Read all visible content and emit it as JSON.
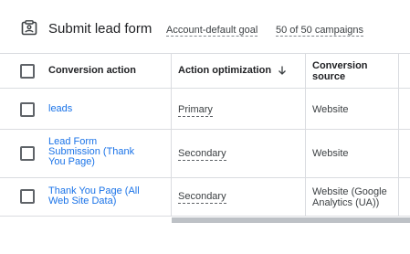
{
  "header": {
    "title": "Submit lead form",
    "goal_label": "Account-default goal",
    "campaigns_label": "50 of 50 campaigns"
  },
  "table": {
    "columns": {
      "action": "Conversion action",
      "optimization": "Action optimization",
      "source_line1": "Conversion",
      "source_line2": "source"
    },
    "rows": [
      {
        "action_lines": [
          "leads"
        ],
        "optimization": "Primary",
        "source_lines": [
          "Website"
        ]
      },
      {
        "action_lines": [
          "Lead Form",
          "Submission (Thank",
          "You Page)"
        ],
        "optimization": "Secondary",
        "source_lines": [
          "Website"
        ]
      },
      {
        "action_lines": [
          "Thank You Page (All",
          "Web Site Data)"
        ],
        "optimization": "Secondary",
        "source_lines": [
          "Website (Google",
          "Analytics (UA))"
        ]
      }
    ]
  },
  "colors": {
    "link": "#1a73e8",
    "border": "#dadce0",
    "text": "#202124"
  },
  "icons": [
    "form-icon",
    "arrow-down-icon",
    "checkbox-icon"
  ]
}
